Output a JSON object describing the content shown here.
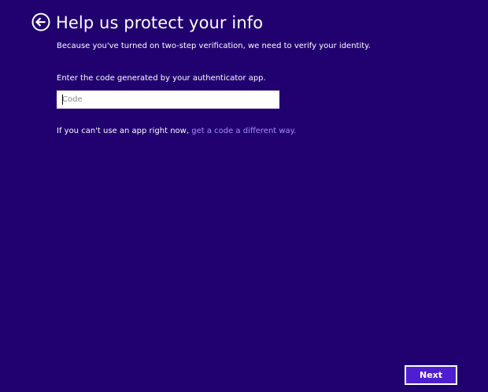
{
  "header": {
    "back_icon": "back-arrow-circle-icon",
    "title": "Help us protect your info",
    "subtitle": "Because you've turned on two-step verification, we need to verify your identity."
  },
  "form": {
    "prompt": "Enter the code generated by your authenticator app.",
    "code_placeholder": "Code",
    "code_value": ""
  },
  "alternative": {
    "text": "If you can't use an app right now, ",
    "link_label": "get a code a different way."
  },
  "footer": {
    "next_label": "Next"
  },
  "colors": {
    "background": "#210070",
    "link": "#a58ef5",
    "next_button": "#4e1fd0"
  }
}
